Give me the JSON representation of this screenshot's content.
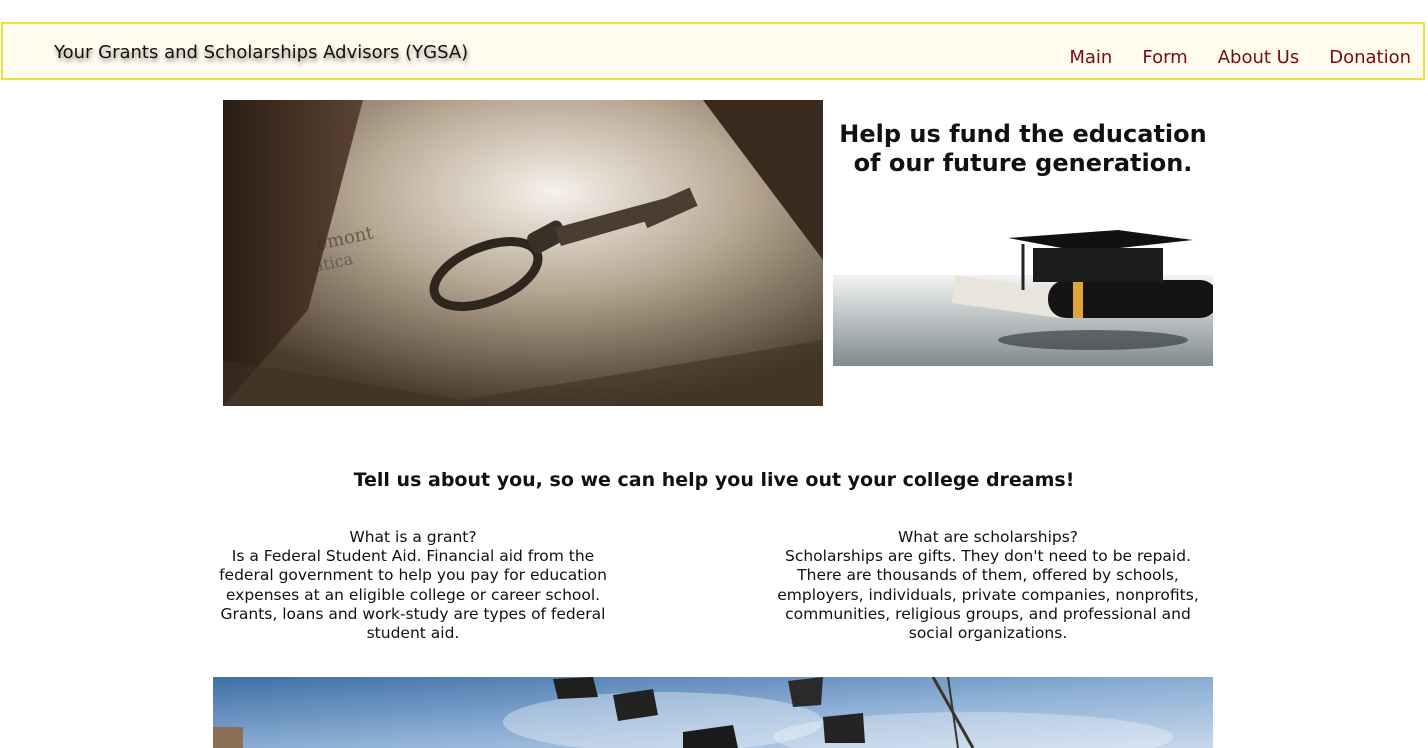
{
  "header": {
    "brand": "Your Grants and Scholarships Advisors (YGSA)",
    "nav": [
      "Main",
      "Form",
      "About Us",
      "Donation"
    ]
  },
  "hero": {
    "image": "antique-key-photo",
    "headline": "Help us fund the education of our future generation.",
    "side_image": "graduation-cap-diploma-photo"
  },
  "tagline": "Tell us about you, so we can help you live out your college dreams!",
  "grant": {
    "question": "What is a grant?",
    "answer": "Is a Federal Student Aid. Financial aid from the federal government to help you pay for education expenses at an eligible college or career school. Grants, loans and work-study are types of federal student aid."
  },
  "scholarship": {
    "question": "What are scholarships?",
    "answer": "Scholarships are gifts. They don't need to be repaid. There are thousands of them, offered by schools, employers, individuals, private companies, nonprofits, communities, religious groups, and professional and social organizations."
  },
  "footer_image": "graduation-caps-thrown-in-sky-photo",
  "colors": {
    "nav_link": "#7b0c0c",
    "header_bg": "#fefbef",
    "header_border": "#f0dd3e"
  }
}
